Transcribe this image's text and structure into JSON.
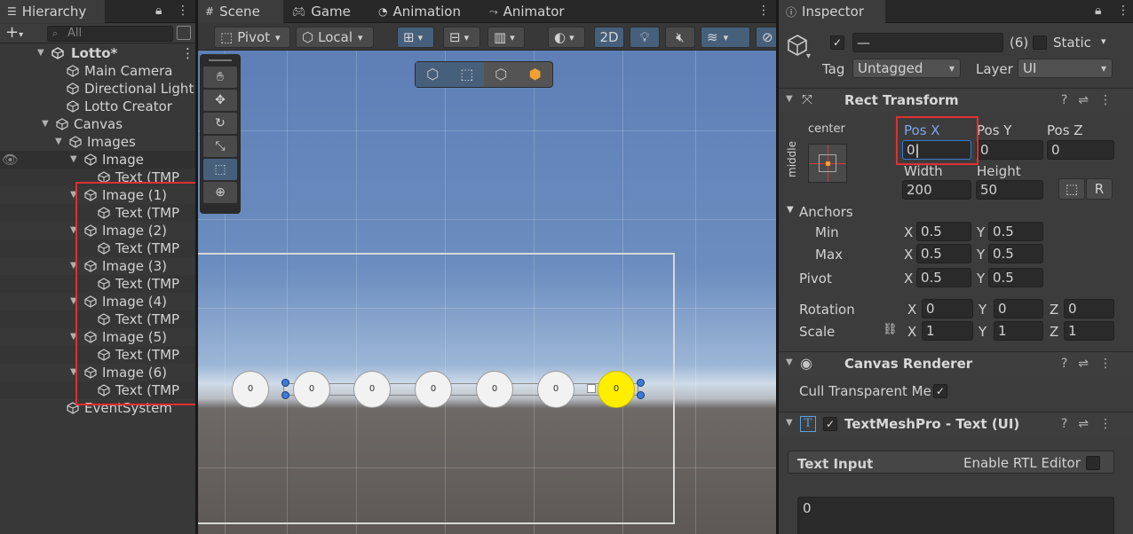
{
  "hierarchy": {
    "tab_label": "Hierarchy",
    "search_placeholder": "All",
    "add_label": "+",
    "scene_name": "Lotto*",
    "items": [
      {
        "label": "Main Camera"
      },
      {
        "label": "Directional Light"
      },
      {
        "label": "Lotto Creator"
      },
      {
        "label": "Canvas"
      },
      {
        "label": "Images"
      },
      {
        "label": "Image"
      },
      {
        "label": "Text (TMP"
      },
      {
        "label": "Image (1)"
      },
      {
        "label": "Text (TMP"
      },
      {
        "label": "Image (2)"
      },
      {
        "label": "Text (TMP"
      },
      {
        "label": "Image (3)"
      },
      {
        "label": "Text (TMP"
      },
      {
        "label": "Image (4)"
      },
      {
        "label": "Text (TMP"
      },
      {
        "label": "Image (5)"
      },
      {
        "label": "Text (TMP"
      },
      {
        "label": "Image (6)"
      },
      {
        "label": "Text (TMP"
      },
      {
        "label": "EventSystem"
      }
    ]
  },
  "scene": {
    "tabs": [
      {
        "label": "Scene"
      },
      {
        "label": "Game"
      },
      {
        "label": "Animation"
      },
      {
        "label": "Animator"
      }
    ],
    "pivot_label": "Pivot",
    "local_label": "Local",
    "mode_2d_label": "2D",
    "balls": [
      "0",
      "0",
      "0",
      "0",
      "0",
      "0",
      "0"
    ]
  },
  "inspector": {
    "tab_label": "Inspector",
    "object_name": "—",
    "count_label": "(6)",
    "static_label": "Static",
    "tag_label": "Tag",
    "tag_value": "Untagged",
    "layer_label": "Layer",
    "layer_value": "UI",
    "rect_transform": {
      "title": "Rect Transform",
      "center_label": "center",
      "middle_label": "middle",
      "pos_x_label": "Pos X",
      "pos_y_label": "Pos Y",
      "pos_z_label": "Pos Z",
      "pos_x": "0",
      "pos_y": "0",
      "pos_z": "0",
      "width_label": "Width",
      "height_label": "Height",
      "width": "200",
      "height": "50",
      "anchors_label": "Anchors",
      "min_label": "Min",
      "max_label": "Max",
      "pivot_label": "Pivot",
      "x_label": "X",
      "y_label": "Y",
      "z_label": "Z",
      "min_x": "0.5",
      "min_y": "0.5",
      "max_x": "0.5",
      "max_y": "0.5",
      "pivot_x": "0.5",
      "pivot_y": "0.5",
      "rotation_label": "Rotation",
      "rot_x": "0",
      "rot_y": "0",
      "rot_z": "0",
      "scale_label": "Scale",
      "scale_x": "1",
      "scale_y": "1",
      "scale_z": "1"
    },
    "canvas_renderer": {
      "title": "Canvas Renderer",
      "cull_label": "Cull Transparent Me"
    },
    "textmeshpro": {
      "title": "TextMeshPro - Text (UI)",
      "text_input_label": "Text Input",
      "rtl_label": "Enable RTL Editor",
      "text_value": "0"
    }
  },
  "colors": {
    "accent": "#46607c",
    "highlight": "#e03030",
    "ball_yellow": "#ffee00"
  }
}
